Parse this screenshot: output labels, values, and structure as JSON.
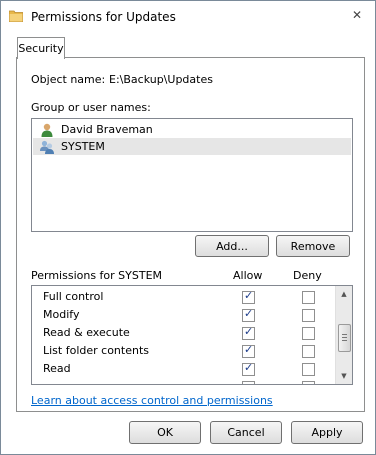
{
  "window": {
    "title": "Permissions for Updates"
  },
  "tabs": [
    {
      "label": "Security"
    }
  ],
  "object": {
    "label": "Object name:",
    "value": "E:\\Backup\\Updates"
  },
  "groups": {
    "label": "Group or user names:",
    "items": [
      {
        "name": "David Braveman",
        "icon": "user-icon",
        "selected": false
      },
      {
        "name": "SYSTEM",
        "icon": "users-group-icon",
        "selected": true
      }
    ],
    "add_label": "Add...",
    "remove_label": "Remove"
  },
  "permissions": {
    "title": "Permissions for SYSTEM",
    "allow_header": "Allow",
    "deny_header": "Deny",
    "rows": [
      {
        "name": "Full control",
        "allow": true,
        "deny": false
      },
      {
        "name": "Modify",
        "allow": true,
        "deny": false
      },
      {
        "name": "Read & execute",
        "allow": true,
        "deny": false
      },
      {
        "name": "List folder contents",
        "allow": true,
        "deny": false
      },
      {
        "name": "Read",
        "allow": true,
        "deny": false
      }
    ]
  },
  "link": {
    "text": "Learn about access control and permissions"
  },
  "footer": {
    "ok_label": "OK",
    "cancel_label": "Cancel",
    "apply_label": "Apply"
  },
  "colors": {
    "link": "#0066cc",
    "selection": "#e6e6e6",
    "check": "#1d3c8a"
  }
}
